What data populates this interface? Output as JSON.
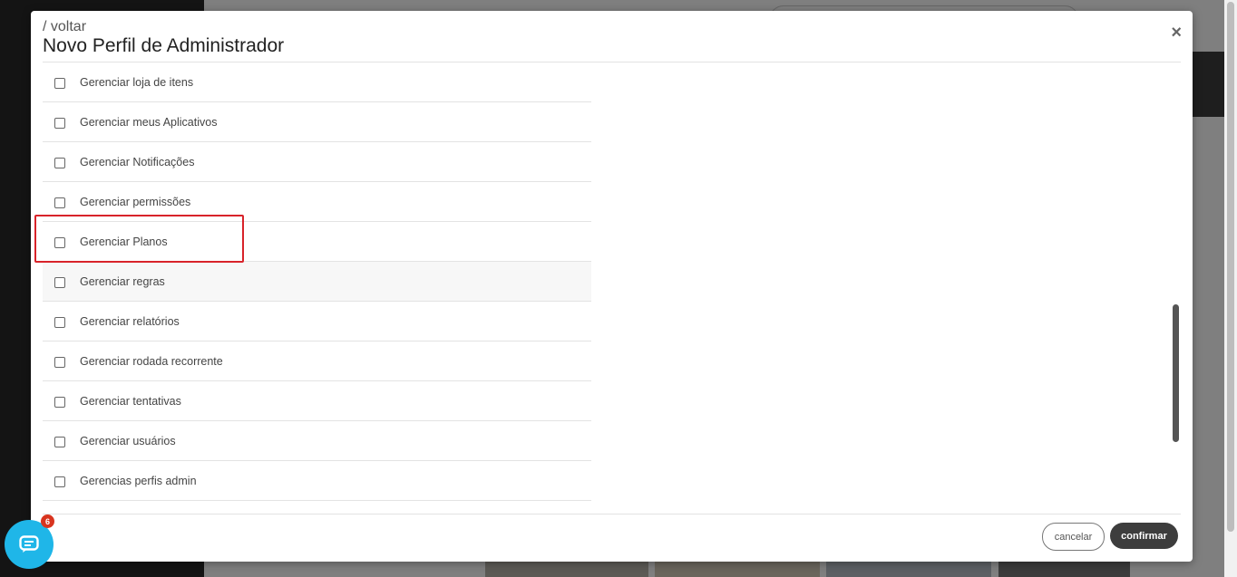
{
  "modal": {
    "breadcrumb": "/ voltar",
    "title": "Novo Perfil de Administrador",
    "close_icon": "×"
  },
  "permissions": [
    {
      "label": "Gerenciar loja de itens",
      "checked": false
    },
    {
      "label": "Gerenciar meus Aplicativos",
      "checked": false
    },
    {
      "label": "Gerenciar Notificações",
      "checked": false
    },
    {
      "label": "Gerenciar permissões",
      "checked": false
    },
    {
      "label": "Gerenciar Planos",
      "checked": false
    },
    {
      "label": "Gerenciar regras",
      "checked": false
    },
    {
      "label": "Gerenciar relatórios",
      "checked": false
    },
    {
      "label": "Gerenciar rodada recorrente",
      "checked": false
    },
    {
      "label": "Gerenciar tentativas",
      "checked": false
    },
    {
      "label": "Gerenciar usuários",
      "checked": false
    },
    {
      "label": "Gerencias perfis admin",
      "checked": false
    }
  ],
  "footer": {
    "cancel_label": "cancelar",
    "confirm_label": "confirmar"
  },
  "chat_widget": {
    "icon": "chat-icon",
    "badge_count": "6"
  },
  "colors": {
    "accent_dark": "#3d3d3d",
    "highlight_red": "#d8232a",
    "chat_blue": "#1fb6e8",
    "badge_red": "#d8341f"
  }
}
